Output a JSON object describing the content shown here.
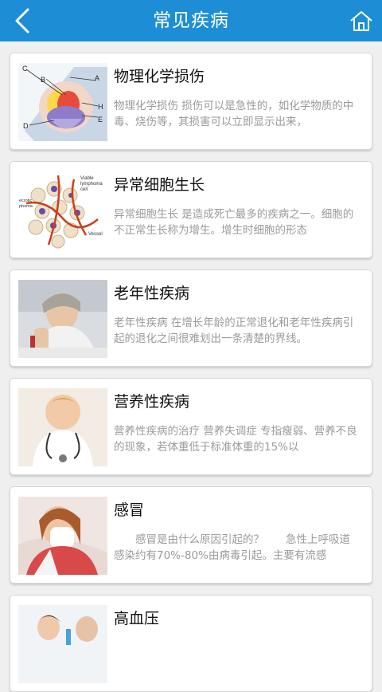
{
  "header": {
    "title": "常见疾病",
    "back_icon": "back-arrow-icon",
    "home_icon": "home-icon",
    "background_color": "#1d8ed6"
  },
  "diseases": [
    {
      "title": "物理化学损伤",
      "desc": "物理化学损伤 损伤可以是急性的，如化学物质的中毒、烧伤等，其损害可以立即显示出来，",
      "thumb_labels": [
        "C",
        "B",
        "A",
        "H",
        "E",
        "D"
      ]
    },
    {
      "title": "异常细胞生长",
      "desc": "异常细胞生长 是造成死亡最多的疾病之一。细胞的不正常生长称为增生。增生时细胞的形态",
      "thumb_labels": [
        "Viable lymphoma cell",
        "Necrotic lymphoma",
        "Vessel"
      ]
    },
    {
      "title": "老年性疾病",
      "desc": "老年性疾病 在增长年龄的正常退化和老年性疾病引起的退化之间很难划出一条清楚的界线。"
    },
    {
      "title": "营养性疾病",
      "desc": "营养性疾病的治疗 营养失调症 专指瘦弱、营养不良的现象，若体重低于标准体重的15%以"
    },
    {
      "title": "感冒",
      "desc": "　　感冒是由什么原因引起的？　　急性上呼吸道感染约有70%-80%由病毒引起。主要有流感"
    },
    {
      "title": "高血压",
      "desc": ""
    }
  ]
}
